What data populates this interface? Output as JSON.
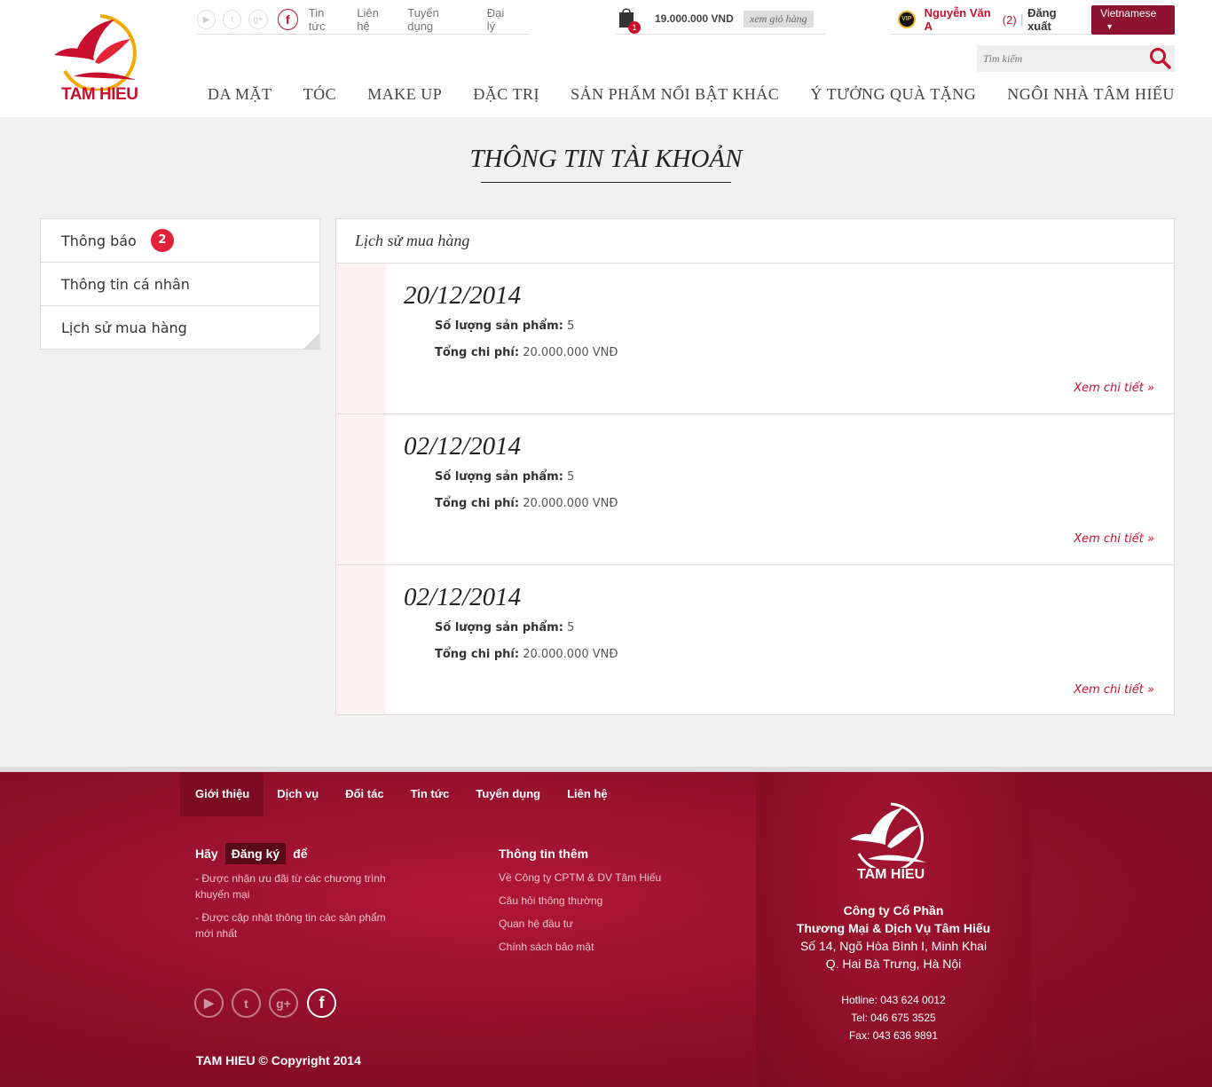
{
  "brand": {
    "name": "TAM HIEU",
    "accent": "#c8102e",
    "dark_red": "#8c1230"
  },
  "topbar": {
    "social_icons": [
      "youtube-icon",
      "twitter-icon",
      "google-plus-icon",
      "facebook-icon"
    ],
    "links": [
      "Tin tức",
      "Liên hệ",
      "Tuyển dụng",
      "Đại lý"
    ]
  },
  "cart": {
    "count": "1",
    "total": "19.000.000 VND",
    "view_label": "xem giỏ hàng"
  },
  "user": {
    "vip_label": "VIP",
    "name": "Nguyễn Văn A",
    "count": "(2)",
    "separator": "|",
    "logout": "Đăng xuất",
    "language": "Vietnamese"
  },
  "search": {
    "placeholder": "Tìm kiếm"
  },
  "nav": [
    "DA MẶT",
    "TÓC",
    "MAKE UP",
    "ĐẶC TRỊ",
    "SẢN PHẨM NỔI BẬT KHÁC",
    "Ý TƯỞNG QUÀ TẶNG",
    "NGÔI NHÀ TÂM HIẾU"
  ],
  "page": {
    "title": "THÔNG TIN TÀI KHOẢN"
  },
  "sidebar": {
    "items": [
      {
        "label": "Thông báo",
        "badge": "2"
      },
      {
        "label": "Thông tin cá nhân"
      },
      {
        "label": "Lịch sử mua hàng"
      }
    ]
  },
  "history": {
    "title": "Lịch sử mua hàng",
    "qty_label": "Số lượng sản phẩm:",
    "cost_label": "Tổng chi phí:",
    "detail_label": "Xem chi tiết »",
    "orders": [
      {
        "date": "20/12/2014",
        "qty": "5",
        "cost": "20.000.000 VNĐ"
      },
      {
        "date": "02/12/2014",
        "qty": "5",
        "cost": "20.000.000 VNĐ"
      },
      {
        "date": "02/12/2014",
        "qty": "5",
        "cost": "20.000.000 VNĐ"
      }
    ]
  },
  "footer": {
    "nav": [
      "Giới thiệu",
      "Dịch vụ",
      "Đối tác",
      "Tin tức",
      "Tuyển dụng",
      "Liên hệ"
    ],
    "register": {
      "before": "Hãy",
      "button": "Đăng ký",
      "after": "để"
    },
    "bullets": [
      "- Được nhận ưu đãi từ các chương trình khuyến mại",
      "- Được cập nhật thông tin các sản phẩm mới nhất"
    ],
    "more_title": "Thông tin thêm",
    "more_links": [
      "Về Công ty CPTM & DV Tâm Hiếu",
      "Câu hỏi thông thường",
      "Quan hệ đầu tư",
      "Chính sách bảo mật"
    ],
    "social_icons": [
      "youtube-icon",
      "twitter-icon",
      "google-plus-icon",
      "facebook-icon"
    ],
    "copyright": "TAM HIEU © Copyright 2014",
    "logo_text": "TAM HIEU",
    "company": [
      "Công ty Cổ Phần",
      "Thương Mại & Dịch Vụ Tâm Hiếu"
    ],
    "address": [
      "Số 14, Ngõ Hòa Bình I, Minh Khai",
      "Q. Hai Bà Trưng, Hà Nội"
    ],
    "contacts": [
      "Hotline: 043 624 0012",
      "Tel: 046 675 3525",
      "Fax: 043 636 9891"
    ]
  }
}
